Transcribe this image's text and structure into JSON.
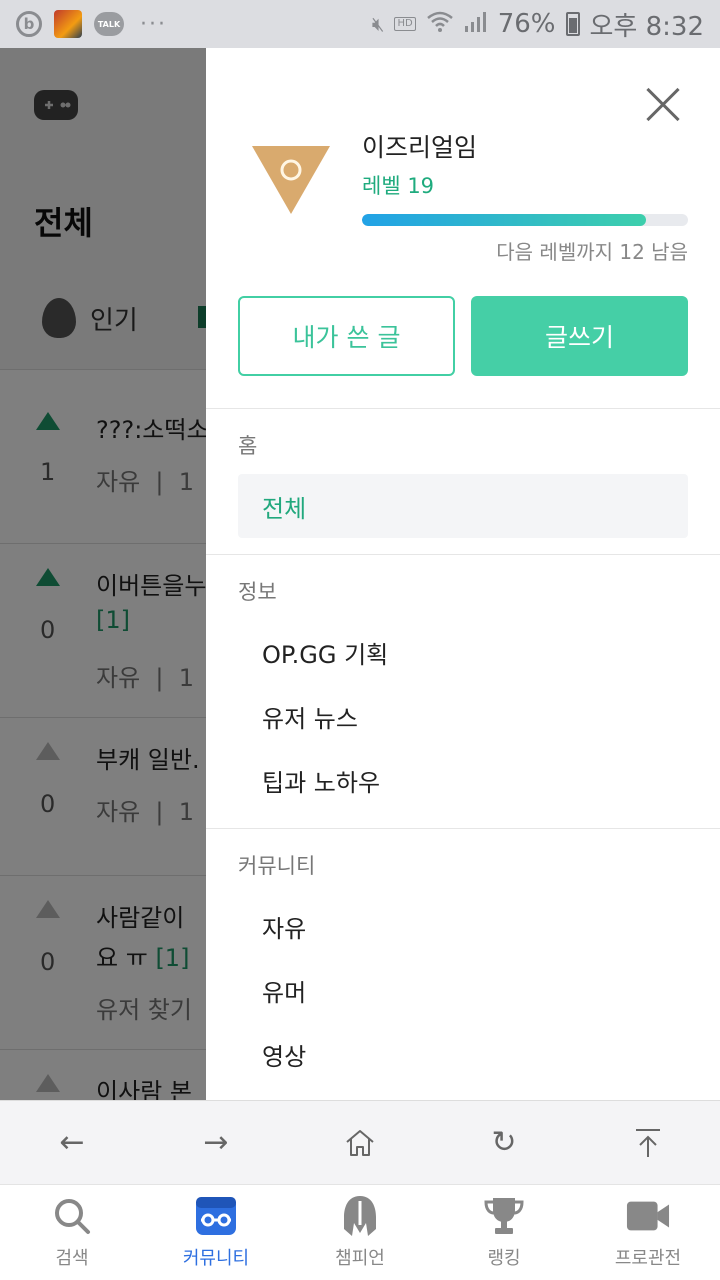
{
  "status_bar": {
    "app_badge": "b",
    "talk_label": "TALK",
    "more": "···",
    "hd_label": "HD",
    "battery": "76%",
    "time": "오후 8:32"
  },
  "background": {
    "title": "전체",
    "tab_popular": "인기",
    "posts": [
      {
        "votes": "1",
        "title": "???:소떡소",
        "comments": "",
        "meta_cat": "자유",
        "meta_time": "1",
        "up": true
      },
      {
        "votes": "0",
        "title": "이버튼을누",
        "comments": "[1]",
        "meta_cat": "자유",
        "meta_time": "1",
        "up": true
      },
      {
        "votes": "0",
        "title": "부캐 일반.",
        "comments": "",
        "meta_cat": "자유",
        "meta_time": "1",
        "up": false
      },
      {
        "votes": "0",
        "title": "사람같이",
        "title2": "요 ㅠ",
        "comments": "[1]",
        "meta_cat": "유저 찾기",
        "meta_time": "",
        "up": false
      },
      {
        "votes": "",
        "title": "이사람 본",
        "comments": "",
        "meta_cat": "",
        "meta_time": "",
        "up": false
      }
    ]
  },
  "drawer": {
    "username": "이즈리얼임",
    "level": "레벨 19",
    "progress": 0.87,
    "next_level": "다음 레벨까지 12 남음",
    "btn_my_posts": "내가 쓴 글",
    "btn_write": "글쓰기",
    "sections": {
      "home": {
        "title": "홈",
        "items": [
          "전체"
        ]
      },
      "info": {
        "title": "정보",
        "items": [
          "OP.GG 기획",
          "유저 뉴스",
          "팁과 노하우"
        ]
      },
      "community": {
        "title": "커뮤니티",
        "items": [
          "자유",
          "유머",
          "영상"
        ]
      }
    }
  },
  "browser_bar": {
    "back": "←",
    "forward": "→",
    "home": "home-icon",
    "refresh": "↻",
    "top": "top-icon"
  },
  "bottom_nav": [
    {
      "label": "검색",
      "icon": "search-icon",
      "active": false
    },
    {
      "label": "커뮤니티",
      "icon": "community-icon",
      "active": true
    },
    {
      "label": "챔피언",
      "icon": "champion-icon",
      "active": false
    },
    {
      "label": "랭킹",
      "icon": "trophy-icon",
      "active": false
    },
    {
      "label": "프로관전",
      "icon": "video-icon",
      "active": false
    }
  ],
  "colors": {
    "accent": "#45cfa6",
    "accent_text": "#21a87d",
    "nav_active": "#2e6fe0",
    "rank_icon": "#d9aa6e"
  }
}
